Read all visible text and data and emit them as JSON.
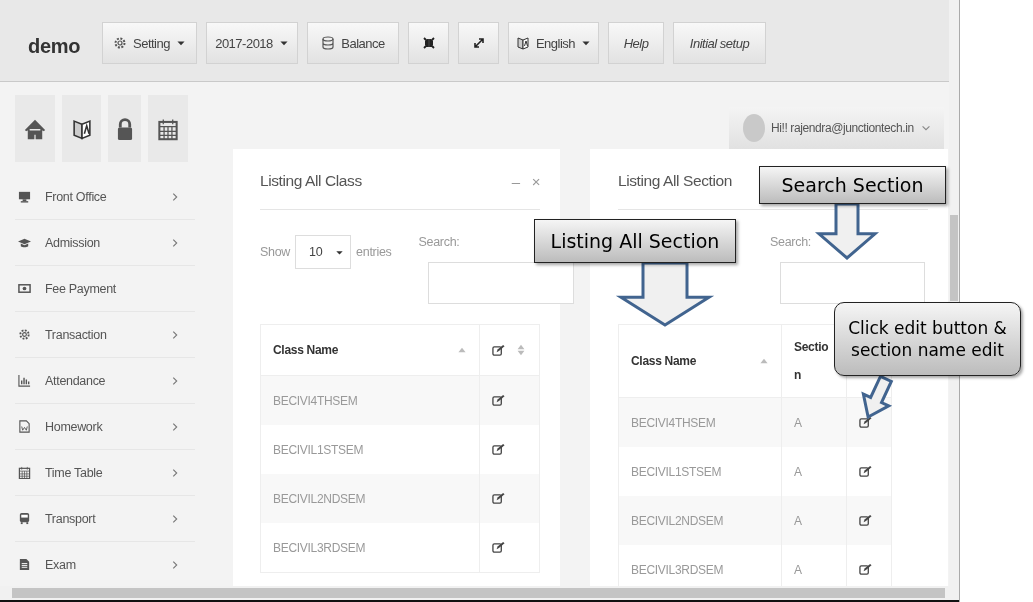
{
  "header": {
    "logo": "demo",
    "buttons": [
      {
        "label": "Setting",
        "dropdown": true,
        "italic": false
      },
      {
        "label": "2017-2018",
        "dropdown": true,
        "italic": false
      },
      {
        "label": "Balance",
        "dropdown": false,
        "italic": false
      },
      {
        "dropdown": false
      },
      {
        "dropdown": false
      },
      {
        "label": "English",
        "dropdown": true,
        "italic": false
      },
      {
        "label": "Help",
        "dropdown": false,
        "italic": true
      },
      {
        "label": "Initial setup",
        "dropdown": false,
        "italic": true
      }
    ]
  },
  "sidebar": {
    "items": [
      {
        "label": "Front Office",
        "has_submenu": true
      },
      {
        "label": "Admission",
        "has_submenu": true
      },
      {
        "label": "Fee Payment",
        "has_submenu": false
      },
      {
        "label": "Transaction",
        "has_submenu": true
      },
      {
        "label": "Attendance",
        "has_submenu": true
      },
      {
        "label": "Homework",
        "has_submenu": true
      },
      {
        "label": "Time Table",
        "has_submenu": true
      },
      {
        "label": "Transport",
        "has_submenu": true
      },
      {
        "label": "Exam",
        "has_submenu": true
      }
    ]
  },
  "user_menu": {
    "greeting": "Hi!! rajendra@junctiontech.in"
  },
  "class_panel": {
    "title": "Listing All Class",
    "minimize": "–",
    "close": "×",
    "show_label": "Show",
    "page_size": "10",
    "entries_label": "entries",
    "search_label": "Search:",
    "columns": [
      {
        "label": "Class Name",
        "sorted": true
      },
      {
        "kind": "edit",
        "sorted": false
      }
    ],
    "rows": [
      {
        "class_name": "BECIVI4THSEM"
      },
      {
        "class_name": "BECIVIL1STSEM"
      },
      {
        "class_name": "BECIVIL2NDSEM"
      },
      {
        "class_name": "BECIVIL3RDSEM"
      }
    ]
  },
  "section_panel": {
    "title": "Listing All Section",
    "search_label": "Search:",
    "columns": [
      {
        "label": "Class Name",
        "sorted": true
      },
      {
        "label": "Section"
      }
    ],
    "rows": [
      {
        "class_name": "BECIVI4THSEM",
        "section": "A"
      },
      {
        "class_name": "BECIVIL1STSEM",
        "section": "A"
      },
      {
        "class_name": "BECIVIL2NDSEM",
        "section": "A"
      },
      {
        "class_name": "BECIVIL3RDSEM",
        "section": "A"
      }
    ]
  },
  "callouts": [
    {
      "text": "Search Section",
      "kind": "box"
    },
    {
      "text": "Listing All Section",
      "kind": "box"
    },
    {
      "text": "Click edit button & section name edit",
      "kind": "rounded"
    }
  ]
}
